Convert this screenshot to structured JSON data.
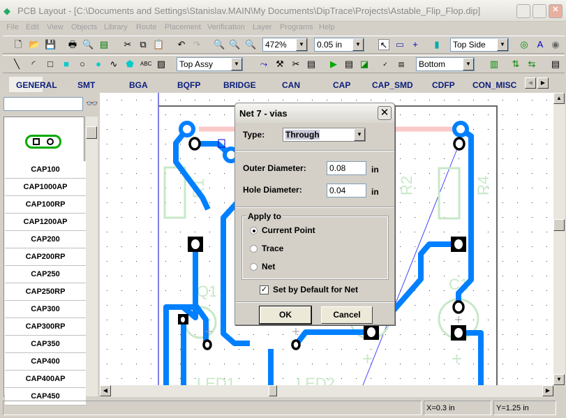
{
  "window": {
    "title": "PCB Layout - [C:\\Documents and Settings\\Stanislav.MAIN\\My Documents\\DipTrace\\Projects\\Astable_Flip_Flop.dip]"
  },
  "menu": [
    "File",
    "Edit",
    "View",
    "Objects",
    "Library",
    "Route",
    "Placement",
    "Verification",
    "Layer",
    "Programs",
    "Help"
  ],
  "toolbar": {
    "zoom": "472%",
    "grid": "0.05 in",
    "side": "Top Side",
    "layer": "Top Assy",
    "route_layer": "Bottom"
  },
  "library_tabs": [
    "GENERAL",
    "SMT",
    "BGA",
    "BQFP",
    "BRIDGE",
    "CAN",
    "CAP",
    "CAP_SMD",
    "CDFP",
    "CON_MISC"
  ],
  "sidebar": {
    "search": "",
    "components": [
      "CAP100",
      "CAP1000AP",
      "CAP100RP",
      "CAP1200AP",
      "CAP200",
      "CAP200RP",
      "CAP250",
      "CAP250RP",
      "CAP300",
      "CAP300RP",
      "CAP350",
      "CAP400",
      "CAP400AP",
      "CAP450"
    ]
  },
  "pcb": {
    "labels": [
      "R1",
      "R2",
      "R4",
      "Q1",
      "C1",
      "LED1",
      "LED2"
    ],
    "trace_color": "#0080ff",
    "silk_color": "#c8e8c8"
  },
  "dialog": {
    "title": "Net 7 - vias",
    "type_label": "Type:",
    "type_value": "Through",
    "outer_label": "Outer Diameter:",
    "outer_value": "0.08",
    "hole_label": "Hole Diameter:",
    "hole_value": "0.04",
    "unit": "in",
    "apply_label": "Apply to",
    "options": [
      "Current Point",
      "Trace",
      "Net"
    ],
    "selected": "Current Point",
    "default_label": "Set by Default for Net",
    "default_checked": true,
    "ok": "OK",
    "cancel": "Cancel"
  },
  "status": {
    "x": "X=0.3 in",
    "y": "Y=1.25 in"
  }
}
